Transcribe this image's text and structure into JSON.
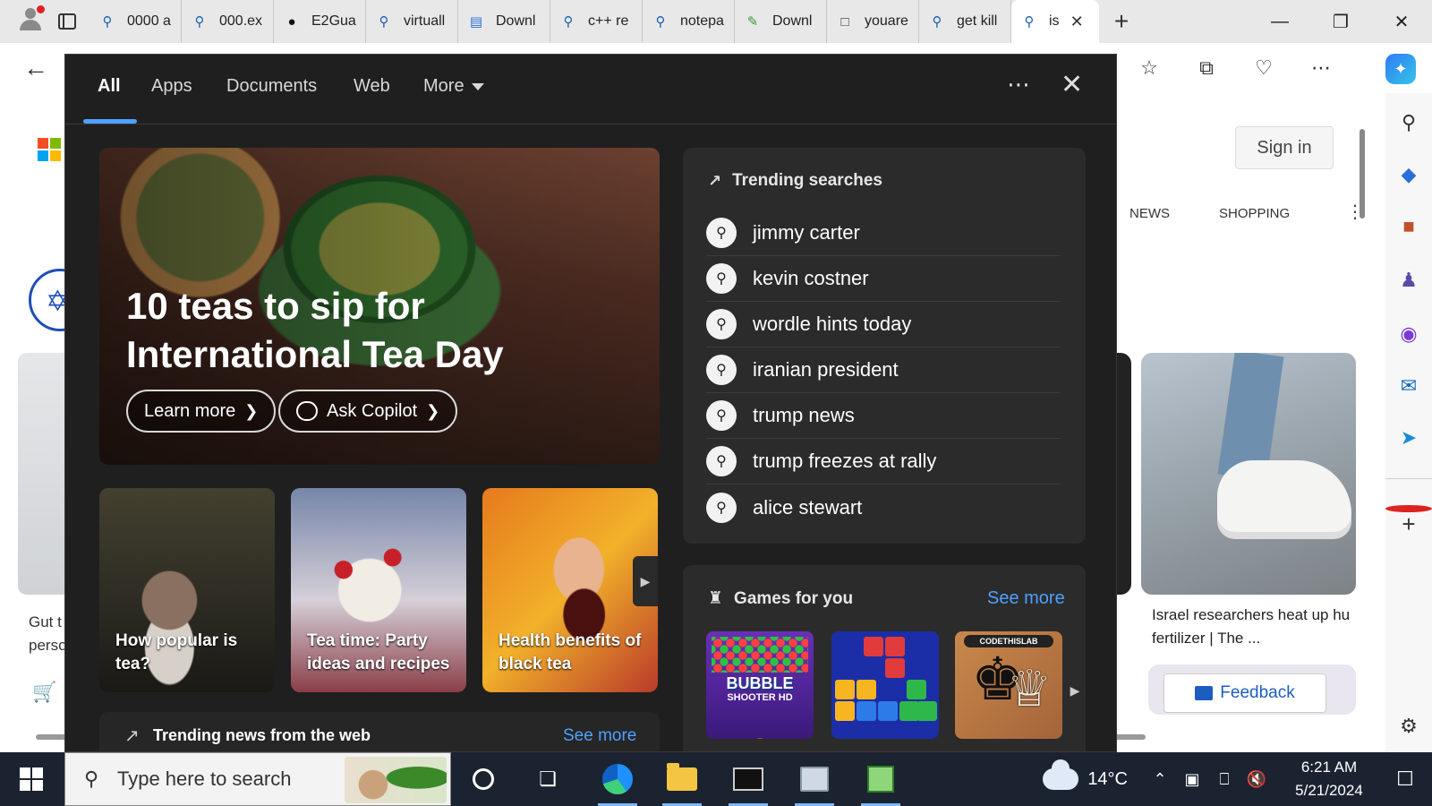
{
  "browser": {
    "tabs": [
      {
        "label": "0000 a",
        "icon": "search-icon"
      },
      {
        "label": "000.ex",
        "icon": "search-icon"
      },
      {
        "label": "E2Gua",
        "icon": "github-icon"
      },
      {
        "label": "virtuall",
        "icon": "search-icon"
      },
      {
        "label": "Downl",
        "icon": "chart-icon"
      },
      {
        "label": "c++ re",
        "icon": "search-icon"
      },
      {
        "label": "notepa",
        "icon": "search-icon"
      },
      {
        "label": "Downl",
        "icon": "notepad-icon"
      },
      {
        "label": "youare",
        "icon": "page-icon"
      },
      {
        "label": "get kill",
        "icon": "search-icon"
      },
      {
        "label": "is",
        "icon": "search-icon",
        "active": true
      }
    ]
  },
  "webpage": {
    "sign_in": "Sign in",
    "scopes": [
      "NEWS",
      "SHOPPING"
    ],
    "left_text": [
      "Gut t",
      "perso"
    ],
    "right_card_text": [
      "Israel researchers heat up hu",
      "fertilizer | The ..."
    ],
    "feedback": "Feedback"
  },
  "overlay": {
    "tabs": [
      "All",
      "Apps",
      "Documents",
      "Web",
      "More"
    ],
    "active_tab": "All",
    "hero": {
      "title": "10 teas to sip for International Tea Day",
      "learn_more": "Learn more",
      "ask_copilot": "Ask Copilot"
    },
    "news_cards": [
      {
        "caption": "How popular is tea?"
      },
      {
        "caption": "Tea time: Party ideas and recipes"
      },
      {
        "caption": "Health benefits of black tea"
      }
    ],
    "trending_news": {
      "title": "Trending news from the web",
      "see_more": "See more"
    },
    "trending_searches": {
      "title": "Trending searches",
      "items": [
        "jimmy carter",
        "kevin costner",
        "wordle hints today",
        "iranian president",
        "trump news",
        "trump freezes at rally",
        "alice stewart"
      ]
    },
    "games": {
      "title": "Games for you",
      "see_more": "See more",
      "tiles": [
        {
          "art_text": "BUBBLE",
          "art_sub": "SHOOTER HD"
        },
        {
          "art_text": ""
        },
        {
          "art_text": "CODETHISLAB"
        }
      ]
    }
  },
  "taskbar": {
    "search_placeholder": "Type here to search",
    "weather_temp": "14°C",
    "time": "6:21 AM",
    "date": "5/21/2024"
  },
  "colors": {
    "accent": "#4ea1ff",
    "overlay_bg": "#1f1f1f",
    "card_bg": "#2b2b2b",
    "taskbar_bg": "#1c2330"
  }
}
